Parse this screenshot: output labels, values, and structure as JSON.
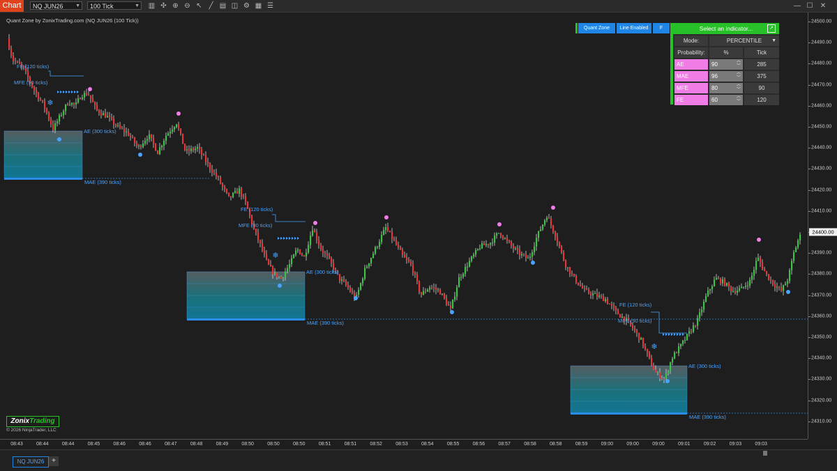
{
  "toolbar": {
    "chart_tab": "Chart",
    "instrument": "NQ JUN26",
    "interval": "100 Tick",
    "icons": [
      "bars-type-icon",
      "crosshair-icon",
      "zoom-in-icon",
      "zoom-out-icon",
      "pointer-icon",
      "draw-line-icon",
      "properties-icon",
      "screenshot-icon",
      "strategies-icon",
      "template-icon",
      "data-box-icon"
    ]
  },
  "chart_subtitle": "Quant Zone by ZonixTrading.com (NQ JUN26 (100 Tick))",
  "panel_buttons": {
    "quant_zone": "Quant Zone",
    "line_enabled": "Line Enabled",
    "f": "F"
  },
  "indicator_panel": {
    "select_label": "Select an indicator...",
    "mode_label": "Mode:",
    "mode_value": "PERCENTILE",
    "prob_label": "Probability:",
    "pct_header": "%",
    "tick_header": "Tick",
    "rows": [
      {
        "name": "AE",
        "pct": "90",
        "tick": "285"
      },
      {
        "name": "MAE",
        "pct": "96",
        "tick": "375"
      },
      {
        "name": "MFE",
        "pct": "80",
        "tick": "90"
      },
      {
        "name": "FE",
        "pct": "60",
        "tick": "120"
      }
    ]
  },
  "price_axis": {
    "labels": [
      "24500.00",
      "24490.00",
      "24480.00",
      "24470.00",
      "24460.00",
      "24450.00",
      "24440.00",
      "24430.00",
      "24420.00",
      "24410.00",
      "24400.00",
      "24390.00",
      "24380.00",
      "24370.00",
      "24360.00",
      "24350.00",
      "24340.00",
      "24330.00",
      "24320.00",
      "24310.00"
    ],
    "current_price": "24400.00"
  },
  "time_axis": {
    "labels": [
      "08:43",
      "08:44",
      "08:44",
      "08:45",
      "08:46",
      "08:46",
      "08:47",
      "08:48",
      "08:49",
      "08:50",
      "08:50",
      "08:50",
      "08:51",
      "08:51",
      "08:52",
      "08:53",
      "08:54",
      "08:55",
      "08:56",
      "08:57",
      "08:58",
      "08:58",
      "08:59",
      "09:00",
      "09:00",
      "09:00",
      "09:01",
      "09:02",
      "09:03",
      "09:03"
    ]
  },
  "zone_labels": {
    "zone1": {
      "fe": "FE (120 ticks)",
      "mfe": "MFE (90 ticks)",
      "ae": "AE (300 ticks)",
      "mae": "MAE (390 ticks)"
    },
    "zone2": {
      "fe": "FE (120 ticks)",
      "mfe": "MFE (90 ticks)",
      "ae": "AE (300 ticks)",
      "mae": "MAE (390 ticks)"
    },
    "zone3": {
      "fe": "FE (120 ticks)",
      "mfe": "MFE (90 ticks)",
      "ae": "AE (300 ticks)",
      "mae": "MAE (390 ticks)"
    }
  },
  "colors": {
    "up_candle": "#3fc24a",
    "down_candle": "#e5363a",
    "zone_blue": "#4aa3ff",
    "accent_green": "#27c227",
    "ae_pink": "#f07ce6"
  },
  "logo": {
    "prefix": "Zonix",
    "suffix": "Trading"
  },
  "copyright": "© 2026 NinjaTrader, LLC",
  "bottom_tab": "NQ JUN26",
  "add_tab": "+"
}
